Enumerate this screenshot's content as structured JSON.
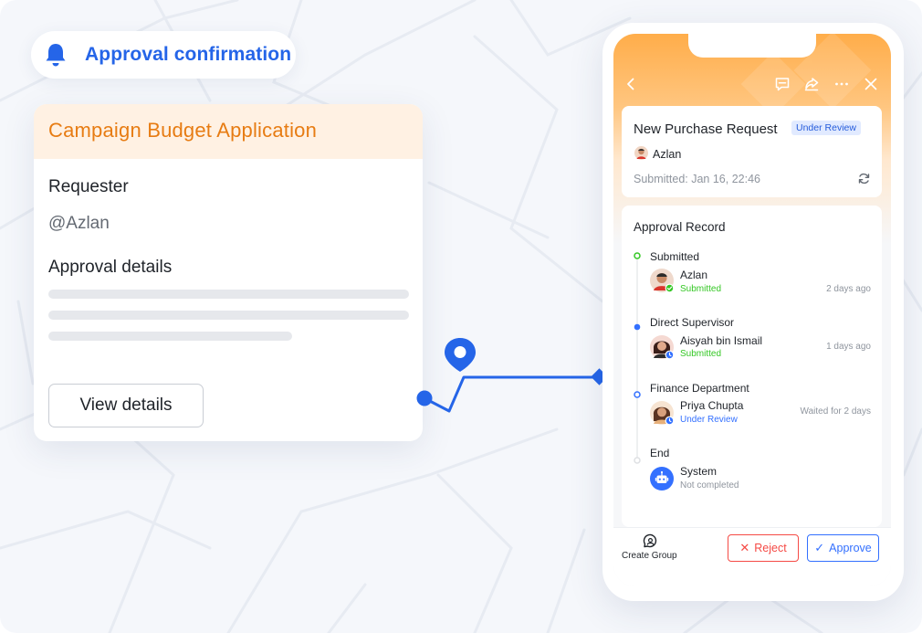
{
  "notification": {
    "title": "Approval confirmation",
    "icon": "bell-icon"
  },
  "application_card": {
    "title": "Campaign Budget Application",
    "requester_label": "Requester",
    "requester_value": "@Azlan",
    "details_label": "Approval details",
    "view_button": "View details"
  },
  "phone": {
    "nav": {
      "back_icon": "chevron-left-icon",
      "actions": [
        "comment-icon",
        "share-icon",
        "more-icon",
        "close-icon"
      ]
    },
    "request": {
      "title": "New Purchase Request",
      "badge": "Under Review",
      "requester": "Azlan",
      "submitted": "Submitted: Jan 16, 22:46"
    },
    "record": {
      "title": "Approval Record",
      "steps": [
        {
          "step": "Submitted",
          "person": "Azlan",
          "status": "Submitted",
          "time": "2 days ago"
        },
        {
          "step": "Direct Supervisor",
          "person": "Aisyah bin Ismail",
          "status": "Submitted",
          "time": "1 days ago"
        },
        {
          "step": "Finance Department",
          "person": "Priya Chupta",
          "status": "Under Review",
          "time": "Waited for 2 days"
        },
        {
          "step": "End",
          "person": "System",
          "status": "Not completed",
          "time": ""
        }
      ]
    },
    "actions": {
      "create_group": "Create Group",
      "reject": "Reject",
      "approve": "Approve"
    }
  },
  "colors": {
    "accent_blue": "#2565e8",
    "orange": "#e77c13",
    "success_green": "#34c724",
    "danger_red": "#f54a45",
    "link_blue": "#3370ff"
  }
}
